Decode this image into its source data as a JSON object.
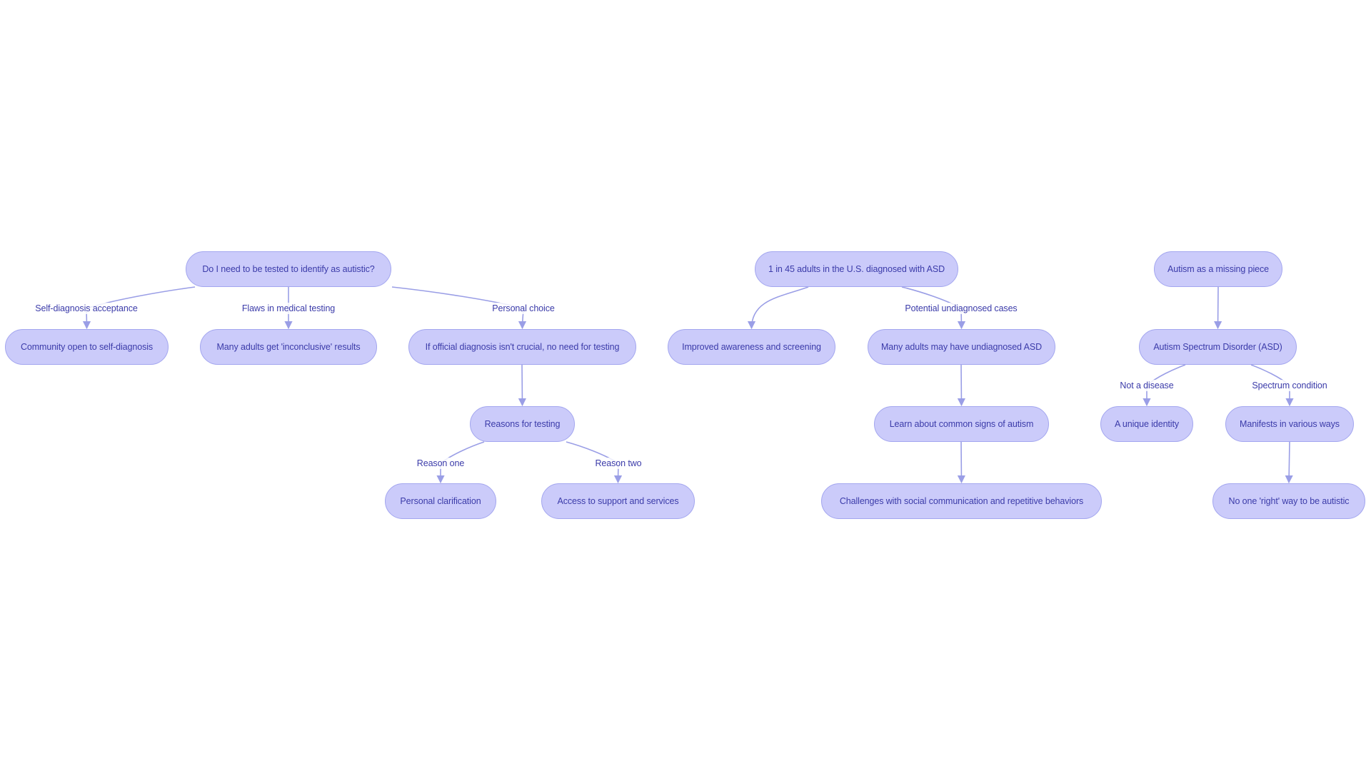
{
  "diagram": {
    "type": "flowchart",
    "colors": {
      "node_fill": "#cbcbfa",
      "node_border": "#a3a6ef",
      "text": "#3b3ba9",
      "edge": "#9a9ee6"
    },
    "nodes": [
      {
        "id": "q_test",
        "label": "Do I need to be tested to identify as autistic?"
      },
      {
        "id": "community",
        "label": "Community open to self-diagnosis"
      },
      {
        "id": "inconclusive",
        "label": "Many adults get 'inconclusive' results"
      },
      {
        "id": "not_crucial",
        "label": "If official diagnosis isn't crucial, no need for testing"
      },
      {
        "id": "reasons",
        "label": "Reasons for testing"
      },
      {
        "id": "clarification",
        "label": "Personal clarification"
      },
      {
        "id": "support",
        "label": "Access to support and services"
      },
      {
        "id": "stat",
        "label": "1 in 45 adults in the U.S. diagnosed with ASD"
      },
      {
        "id": "awareness",
        "label": "Improved awareness and screening"
      },
      {
        "id": "undiagnosed",
        "label": "Many adults may have undiagnosed ASD"
      },
      {
        "id": "signs",
        "label": "Learn about common signs of autism"
      },
      {
        "id": "challenges",
        "label": "Challenges with social communication and repetitive behaviors"
      },
      {
        "id": "missing_piece",
        "label": "Autism as a missing piece"
      },
      {
        "id": "asd",
        "label": "Autism Spectrum Disorder (ASD)"
      },
      {
        "id": "identity",
        "label": "A unique identity"
      },
      {
        "id": "manifests",
        "label": "Manifests in various ways"
      },
      {
        "id": "no_right_way",
        "label": "No one 'right' way to be autistic"
      }
    ],
    "edges": [
      {
        "from": "q_test",
        "to": "community",
        "label": "Self-diagnosis acceptance"
      },
      {
        "from": "q_test",
        "to": "inconclusive",
        "label": "Flaws in medical testing"
      },
      {
        "from": "q_test",
        "to": "not_crucial",
        "label": "Personal choice"
      },
      {
        "from": "not_crucial",
        "to": "reasons",
        "label": ""
      },
      {
        "from": "reasons",
        "to": "clarification",
        "label": "Reason one"
      },
      {
        "from": "reasons",
        "to": "support",
        "label": "Reason two"
      },
      {
        "from": "stat",
        "to": "awareness",
        "label": ""
      },
      {
        "from": "stat",
        "to": "undiagnosed",
        "label": "Potential undiagnosed cases"
      },
      {
        "from": "undiagnosed",
        "to": "signs",
        "label": ""
      },
      {
        "from": "signs",
        "to": "challenges",
        "label": ""
      },
      {
        "from": "missing_piece",
        "to": "asd",
        "label": ""
      },
      {
        "from": "asd",
        "to": "identity",
        "label": "Not a disease"
      },
      {
        "from": "asd",
        "to": "manifests",
        "label": "Spectrum condition"
      },
      {
        "from": "manifests",
        "to": "no_right_way",
        "label": ""
      }
    ]
  }
}
